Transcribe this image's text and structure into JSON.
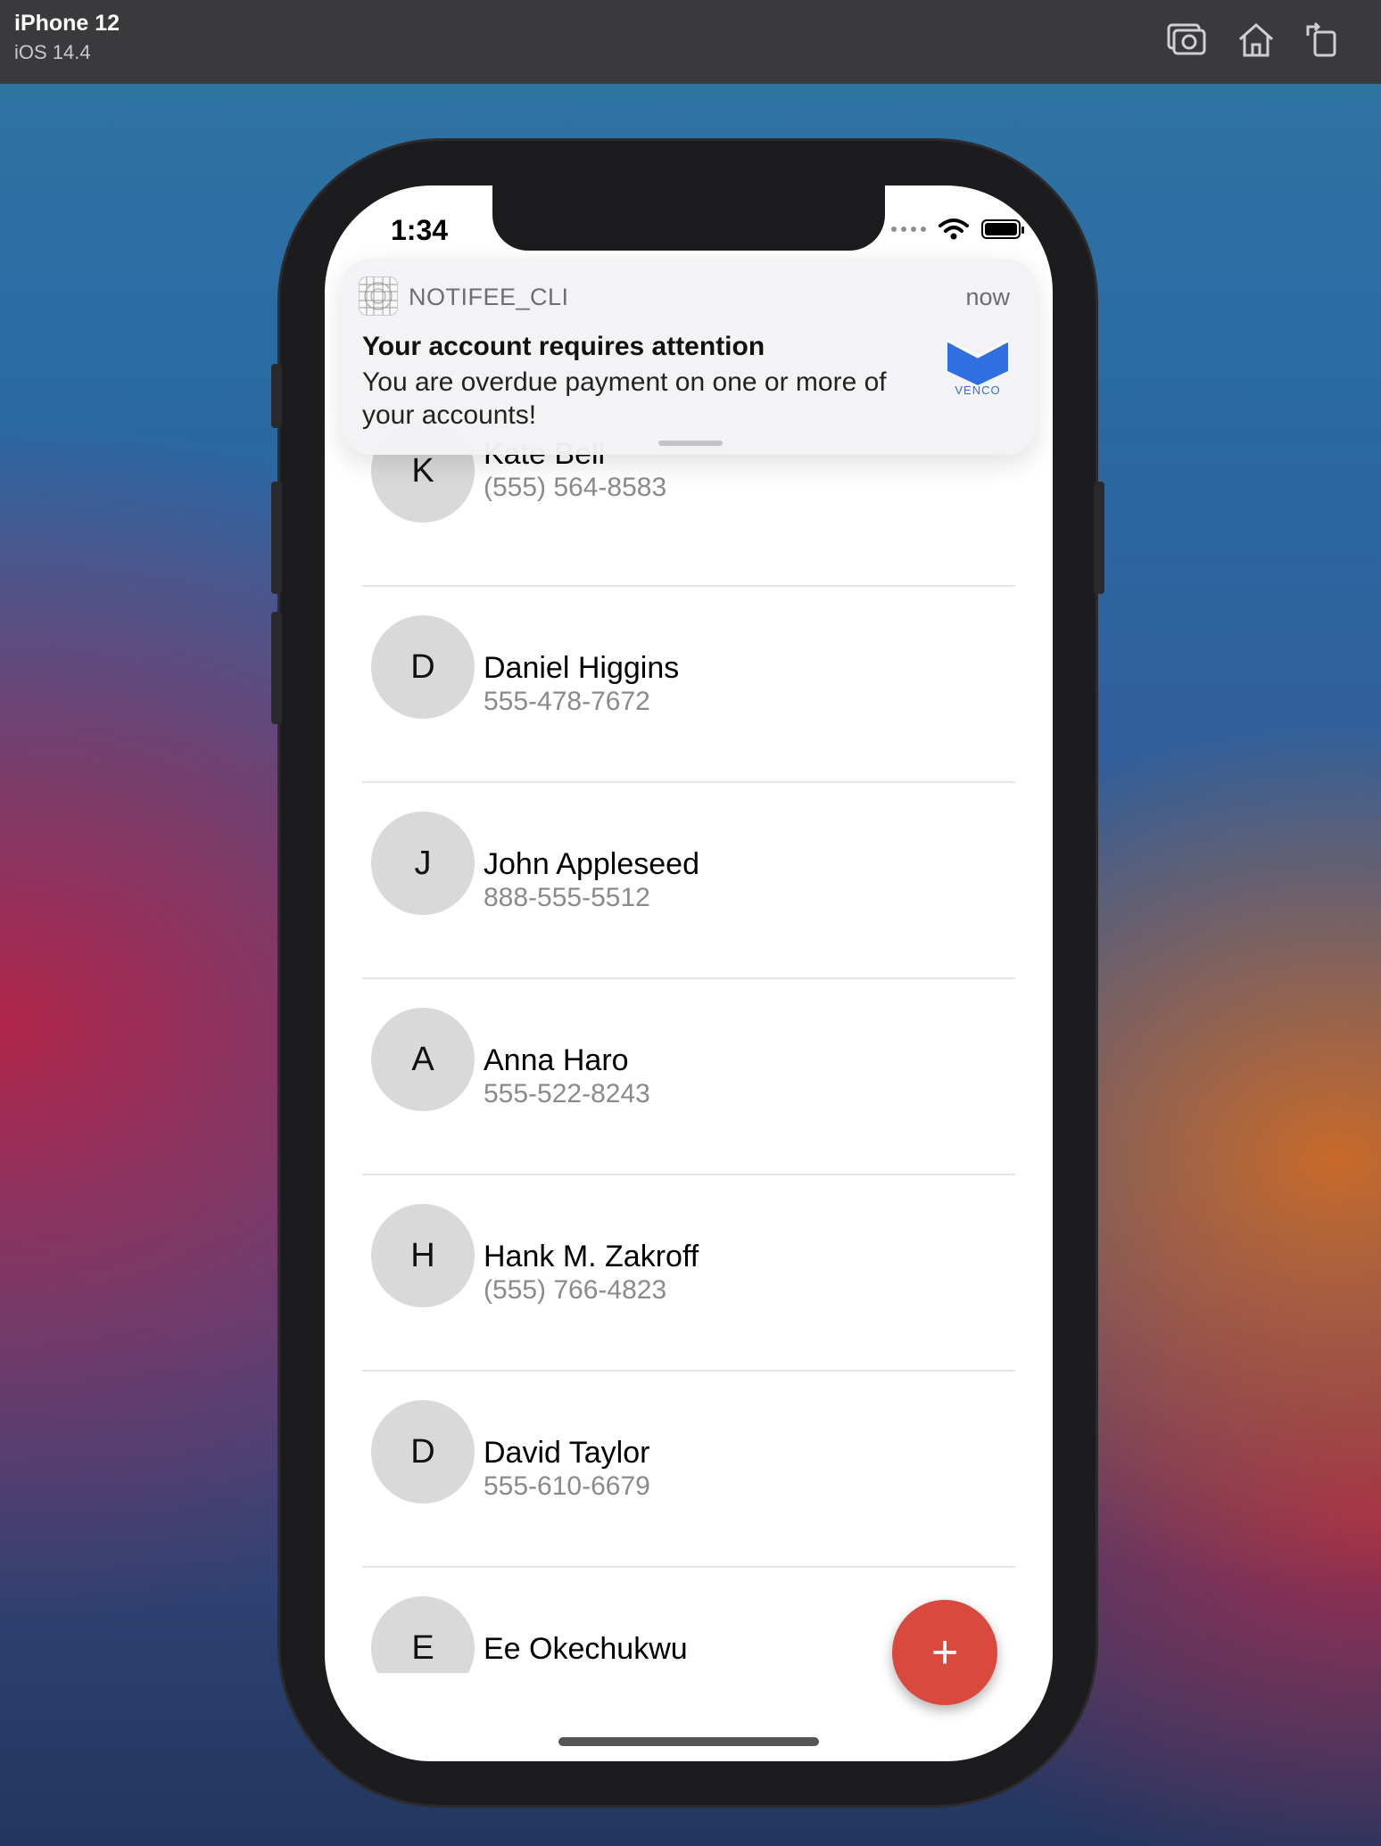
{
  "simulator": {
    "device": "iPhone 12",
    "os": "iOS 14.4",
    "toolbar": [
      "screenshot-icon",
      "home-icon",
      "rotate-icon"
    ]
  },
  "status_bar": {
    "time": "1:34"
  },
  "notification": {
    "app_name": "NOTIFEE_CLI",
    "time": "now",
    "title": "Your account requires attention",
    "body": "You are overdue payment on one or more of your accounts!",
    "thumbnail_text": "VENCO",
    "thumbnail_color": "#2f6fe0"
  },
  "contacts": [
    {
      "initial": "K",
      "name": "Kate Bell",
      "phone": "(555) 564-8583"
    },
    {
      "initial": "D",
      "name": "Daniel Higgins",
      "phone": "555-478-7672"
    },
    {
      "initial": "J",
      "name": "John Appleseed",
      "phone": "888-555-5512"
    },
    {
      "initial": "A",
      "name": "Anna Haro",
      "phone": "555-522-8243"
    },
    {
      "initial": "H",
      "name": "Hank M. Zakroff",
      "phone": "(555) 766-4823"
    },
    {
      "initial": "D",
      "name": "David Taylor",
      "phone": "555-610-6679"
    },
    {
      "initial": "E",
      "name": "Ee Okechukwu",
      "phone": ""
    }
  ],
  "fab": {
    "label": "+",
    "color": "#d9493e"
  }
}
